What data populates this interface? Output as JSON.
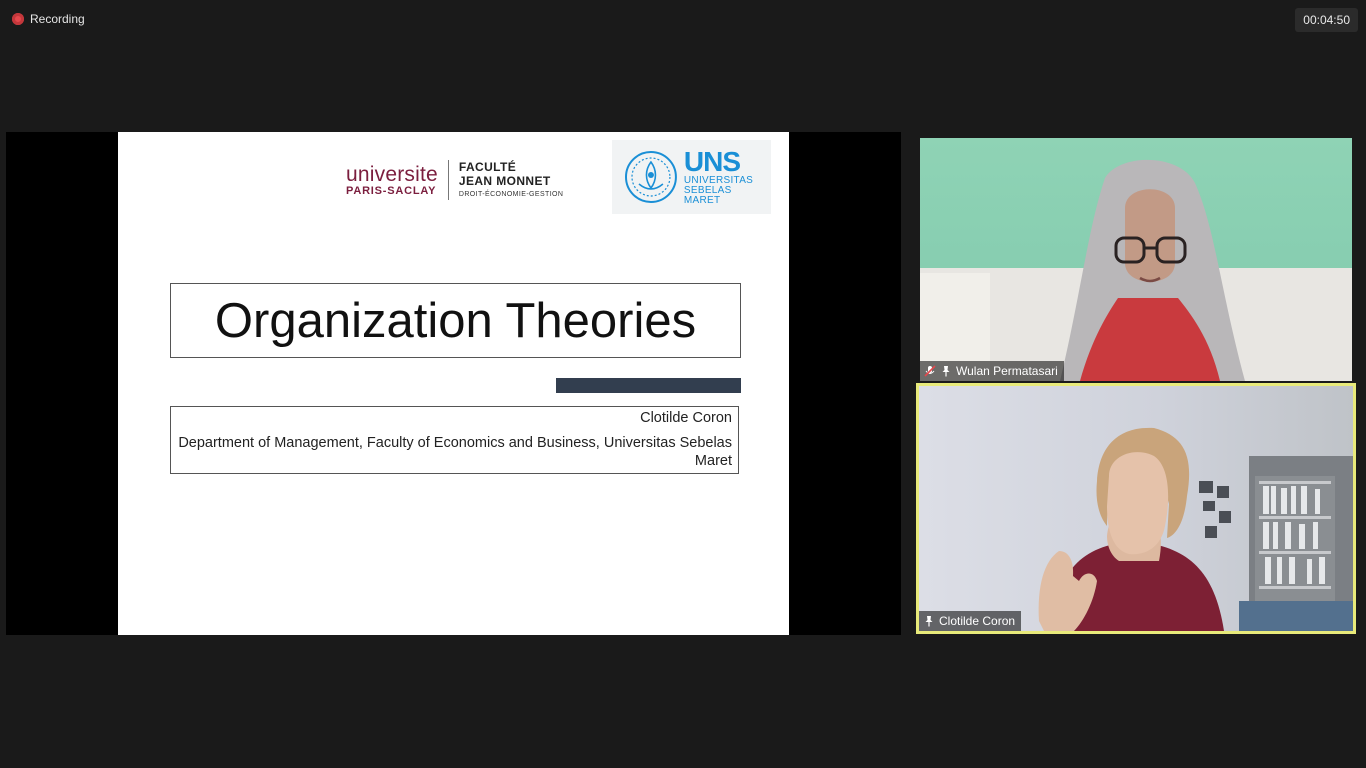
{
  "recording": {
    "label": "Recording"
  },
  "timer": {
    "value": "00:04:50"
  },
  "slide": {
    "logo_paris": {
      "university_name": "universite",
      "university_sub": "PARIS-SACLAY",
      "faculty_line1": "FACULTÉ",
      "faculty_line2": "JEAN MONNET",
      "faculty_line3": "DROIT-ÉCONOMIE-GESTION"
    },
    "logo_uns": {
      "abbr": "UNS",
      "line1": "UNIVERSITAS",
      "line2": "SEBELAS MARET"
    },
    "title": "Organization Theories",
    "subtitle_author": "Clotilde Coron",
    "subtitle_dept": "Department of Management, Faculty of Economics and Business, Universitas Sebelas Maret"
  },
  "participants": [
    {
      "name": "Wulan Permatasari",
      "muted": true,
      "pinned": true,
      "active_speaker": false
    },
    {
      "name": "Clotilde Coron",
      "muted": false,
      "pinned": true,
      "active_speaker": true
    }
  ],
  "colors": {
    "background": "#1a1a1a",
    "active_speaker_border": "#e8ea7a",
    "slide_accent_bar": "#323e4f",
    "paris_saclay": "#7b1e3e",
    "uns_blue": "#1a8fd6",
    "recording_dot": "#e5484d"
  },
  "icons": {
    "recording": "recording-dot-icon",
    "muted": "mic-off-icon",
    "pinned": "pin-icon"
  }
}
